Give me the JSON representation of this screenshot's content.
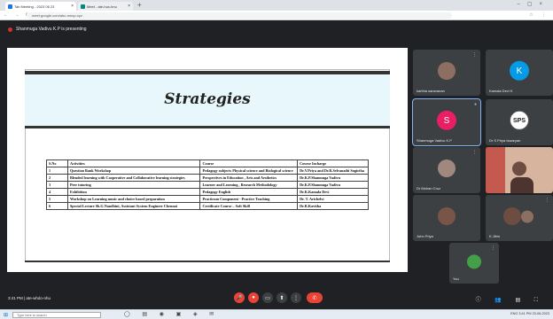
{
  "browser": {
    "tabs": [
      {
        "label": "Tab Meeting - 2023 06 23",
        "fav": "#1a73e8"
      },
      {
        "label": "Meet - ate-hux-hnu",
        "fav": "#00897b"
      }
    ],
    "new_tab": "+",
    "url": "meet.google.com/abc-mnop-xyz",
    "nav_icons": "← → ⟳",
    "ext_icons": "☆ ⋮"
  },
  "meeting": {
    "presenter_banner": "Shanmuga Vadivu K.P is presenting",
    "clock": "3:41 PM  |  ate-whdo-nhu"
  },
  "slide": {
    "title": "Strategies",
    "table": {
      "headers": [
        "S.No",
        "Activities",
        "Course",
        "Course Incharge"
      ],
      "rows": [
        [
          "1",
          "Question Bank Workshop",
          "Pedagogy subjects Physical science and Biological science",
          "Dr.V.Priya and Dr.R.Selvanathi Sugirtha"
        ],
        [
          "2",
          "Blended learning with Cooperative and Collaborative learning strategies",
          "Perspectives in Education , Arts and Aesthetics",
          "Dr.K.P.Shanmuga Vadivu"
        ],
        [
          "3",
          "Peer tutoring",
          "Learner and Learning , Research Methodology",
          "Dr.K.P.Shanmuga Vadivu"
        ],
        [
          "4",
          "Exhibition",
          "Pedagogy English",
          "Dr.K.Kamala Devi"
        ],
        [
          "5",
          "Workshop on Learning music and choice based preparation",
          "Practicum Component - Practice Teaching",
          "Dr. T. Arichelvi"
        ],
        [
          "6",
          "Special Lecture Sh.G.Nandhini, Assistant System Engineer Chennai",
          "Certificate Course – Soft Skill",
          "Dr.R.Kavitha"
        ]
      ]
    }
  },
  "participants": [
    {
      "name": "karthia saravanan",
      "kind": "photo",
      "color": "#8d6e63"
    },
    {
      "name": "Kamala Devi K",
      "kind": "letter",
      "letter": "K",
      "color": "#039be5"
    },
    {
      "name": "Shanmuga Vadivu K.P",
      "kind": "letter",
      "letter": "S",
      "color": "#e91e63"
    },
    {
      "name": "Dr S Priya Iswaryan",
      "kind": "letter",
      "letter": "SPS",
      "color": "#ffffff"
    },
    {
      "name": "Dr Mohan Cruz",
      "kind": "photo",
      "color": "#a1887f"
    },
    {
      "name": "",
      "kind": "video",
      "color": "#d7b49e"
    },
    {
      "name": "John Priya",
      "kind": "photo",
      "color": "#795548"
    },
    {
      "name": "K.Jibin",
      "kind": "photo",
      "color": "#6d4c41"
    },
    {
      "name": "You",
      "kind": "photo",
      "color": "#43a047"
    }
  ],
  "controls": {
    "mic": "🎤",
    "cam": "●",
    "cc": "▭",
    "present": "⬆",
    "more": "⋮",
    "end": "✆",
    "right": "ⓘ 👥 ▤ ⛶"
  },
  "taskbar": {
    "start": "⊞",
    "search": "Type here to search",
    "apps": "◯ ▤ ◉ ▣ ◈ ✉",
    "tray": "ENG  3:41 PM  23-06-2023"
  },
  "colors": {
    "accent": "#8ab4f8",
    "end_call": "#ea4335",
    "meet_bg": "#202124"
  }
}
